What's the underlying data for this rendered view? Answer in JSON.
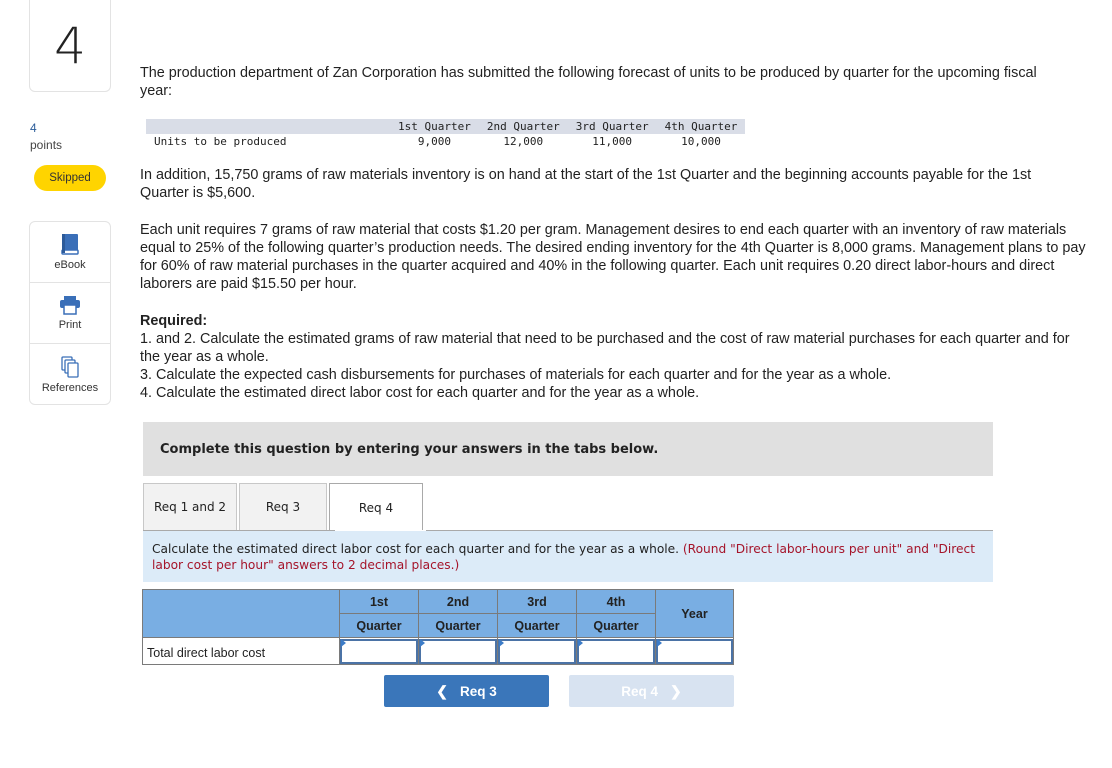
{
  "question": {
    "number": "4",
    "points_value": "4",
    "points_label": "points",
    "status": "Skipped",
    "status_color": "#ffd400"
  },
  "tools": [
    {
      "label": "eBook",
      "icon": "book-icon"
    },
    {
      "label": "Print",
      "icon": "printer-icon"
    },
    {
      "label": "References",
      "icon": "references-icon"
    }
  ],
  "problem": {
    "intro": "The production department of Zan Corporation has submitted the following forecast of units to be produced by quarter for the upcoming fiscal year:",
    "units_table": {
      "headers": [
        "",
        "1st Quarter",
        "2nd Quarter",
        "3rd Quarter",
        "4th Quarter"
      ],
      "row": {
        "label": "Units to be produced",
        "values": [
          "9,000",
          "12,000",
          "11,000",
          "10,000"
        ]
      }
    },
    "para2": "In addition, 15,750 grams of raw materials inventory is on hand at the start of the 1st Quarter and the beginning accounts payable for the 1st Quarter is $5,600.",
    "para3": "Each unit requires 7 grams of raw material that costs $1.20 per gram. Management desires to end each quarter with an inventory of raw materials equal to 25% of the following quarter’s production needs. The desired ending inventory for the 4th Quarter is 8,000 grams. Management plans to pay for 60% of raw material purchases in the quarter acquired and 40% in the following quarter. Each unit requires 0.20 direct labor-hours and direct laborers are paid $15.50 per hour.",
    "required_title": "Required:",
    "required_items": [
      "1. and 2. Calculate the estimated grams of raw material that need to be purchased and the cost of raw material purchases for each quarter and for the year as a whole.",
      "3. Calculate the expected cash disbursements for purchases of materials for each quarter and for the year as a whole.",
      "4. Calculate the estimated direct labor cost for each quarter and for the year as a whole."
    ]
  },
  "banner": "Complete this question by entering your answers in the tabs below.",
  "tabs": [
    {
      "label": "Req 1 and 2",
      "active": false
    },
    {
      "label": "Req 3",
      "active": false
    },
    {
      "label": "Req 4",
      "active": true
    }
  ],
  "instruction": {
    "text": "Calculate the estimated direct labor cost for each quarter and for the year as a whole.",
    "note": "(Round \"Direct labor-hours per unit\" and \"Direct labor cost per hour\" answers to 2 decimal places.)"
  },
  "answer_table": {
    "header_top": [
      "1st",
      "2nd",
      "3rd",
      "4th"
    ],
    "header_bottom": [
      "Quarter",
      "Quarter",
      "Quarter",
      "Quarter"
    ],
    "year_label": "Year",
    "rows": [
      {
        "label": "Total direct labor cost",
        "values": [
          "",
          "",
          "",
          "",
          ""
        ]
      }
    ]
  },
  "nav": {
    "prev_label": "Req 3",
    "next_label": "Req 4",
    "prev_icon": "chevron-left-icon",
    "next_icon": "chevron-right-icon"
  },
  "colors": {
    "accent": "#3a76ba",
    "table_header": "#79aee3",
    "info_bg": "#dcebf8",
    "note_red": "#a5142a"
  }
}
